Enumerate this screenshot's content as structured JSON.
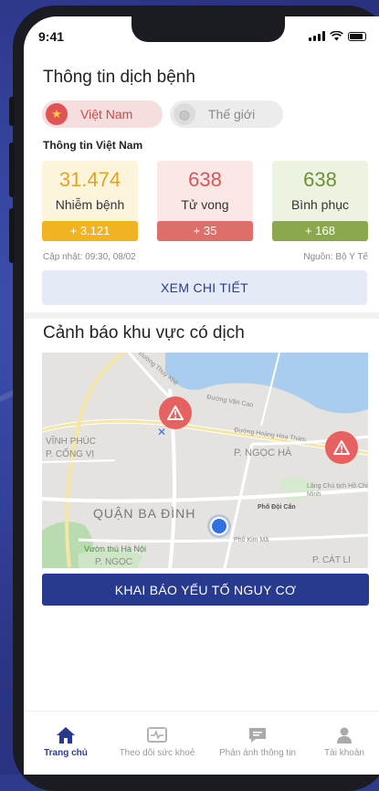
{
  "status_bar": {
    "time": "9:41"
  },
  "header": {
    "title": "Thông tin dịch bệnh"
  },
  "tabs": [
    {
      "label": "Việt Nam",
      "icon": "star-flag-icon",
      "active": true
    },
    {
      "label": "Thế giới",
      "icon": "globe-icon",
      "active": false
    }
  ],
  "stats_section": {
    "title": "Thông tin Việt Nam"
  },
  "stats": [
    {
      "value": "31.474",
      "label": "Nhiễm bệnh",
      "delta": "+ 3.121",
      "color": "#f2b322"
    },
    {
      "value": "638",
      "label": "Tử vong",
      "delta": "+ 35",
      "color": "#df6e6b"
    },
    {
      "value": "638",
      "label": "Bình phục",
      "delta": "+ 168",
      "color": "#8ba84e"
    }
  ],
  "meta": {
    "updated": "Cập nhật: 09:30, 08/02",
    "source": "Nguồn: Bộ Y Tế"
  },
  "detail_button": {
    "label": "XEM CHI TIẾT"
  },
  "warning_section": {
    "title": "Cảnh báo khu vực có dịch"
  },
  "map": {
    "labels": [
      "VĨNH PHÚC",
      "P. CỐNG VỊ",
      "P. NGỌC HÀ",
      "QUẬN BA ĐÌNH",
      "Vườn thú Hà Nội",
      "P. NGỌC",
      "P. CÁT LI",
      "Lăng Chủ tịch Hồ Chí Minh",
      "Phố Đội Cấn",
      "Đường Hoàng Hoa Thám",
      "Đường Văn Cao",
      "Phố Kim Mã",
      "Đường Thụy Khê"
    ]
  },
  "declare_button": {
    "label": "KHAI BÁO YẾU TỐ NGUY CƠ"
  },
  "bottom_nav": [
    {
      "label": "Trang chủ",
      "icon": "home-icon",
      "active": true
    },
    {
      "label": "Theo dõi sức khoẻ",
      "icon": "health-monitor-icon",
      "active": false
    },
    {
      "label": "Phản ánh thông tin",
      "icon": "feedback-chat-icon",
      "active": false
    },
    {
      "label": "Tài khoản",
      "icon": "user-icon",
      "active": false
    }
  ],
  "colors": {
    "primary": "#283a8e",
    "background": "#2e3a8c"
  }
}
